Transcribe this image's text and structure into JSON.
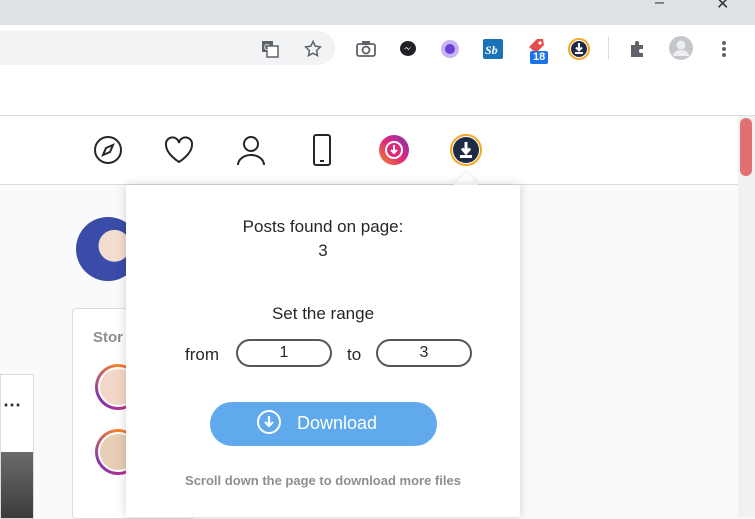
{
  "browser": {
    "window_buttons": {
      "minimize": "–",
      "close": "✕"
    },
    "extensions": {
      "badge_count": "18"
    }
  },
  "popup": {
    "posts_found_label": "Posts found on page:",
    "posts_found_count": "3",
    "range_title": "Set the range",
    "from_label": "from",
    "from_value": "1",
    "to_label": "to",
    "to_value": "3",
    "download_label": "Download",
    "hint": "Scroll down the page to download more files"
  },
  "sidebar": {
    "stories_title": "Stor"
  },
  "colors": {
    "download_button": "#5fa9ec",
    "story_ring": "#dd2a7b"
  }
}
